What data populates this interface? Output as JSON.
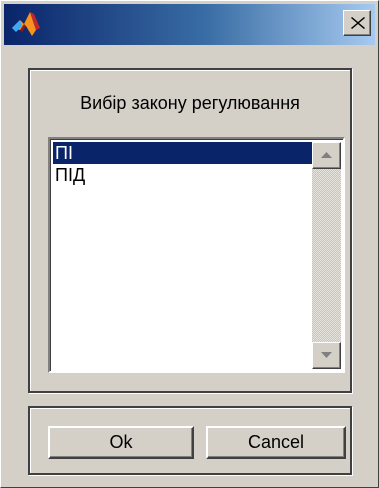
{
  "dialog": {
    "title": "",
    "close_glyph": "×",
    "app_icon": "matlab-logo-icon"
  },
  "group": {
    "label": "Вибір закону регулювання"
  },
  "list": {
    "items": [
      {
        "label": "ПІ",
        "selected": true
      },
      {
        "label": "ПІД",
        "selected": false
      }
    ]
  },
  "buttons": {
    "ok": "Ok",
    "cancel": "Cancel"
  },
  "colors": {
    "selection": "#0a246a",
    "face": "#d4d0c8"
  }
}
